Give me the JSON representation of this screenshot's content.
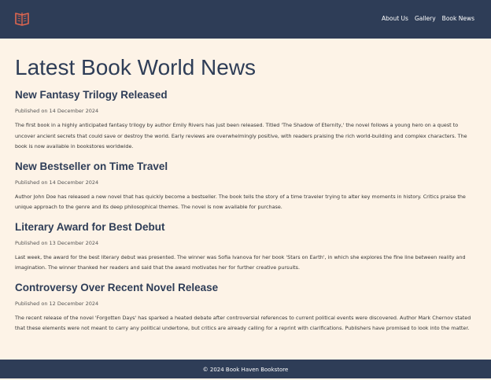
{
  "header": {
    "logo_icon": "book-logo-icon",
    "nav": [
      "About Us",
      "Gallery",
      "Book News"
    ]
  },
  "main": {
    "title": "Latest Book World News",
    "articles": [
      {
        "title": "New Fantasy Trilogy Released",
        "date": "Published on 14 December 2024",
        "body": "The first book in a highly anticipated fantasy trilogy by author Emily Rivers has just been released. Titled 'The Shadow of Eternity,' the novel follows a young hero on a quest to uncover ancient secrets that could save or destroy the world. Early reviews are overwhelmingly positive, with readers praising the rich world-building and complex characters. The book is now available in bookstores worldwide."
      },
      {
        "title": "New Bestseller on Time Travel",
        "date": "Published on 14 December 2024",
        "body": "Author John Doe has released a new novel that has quickly become a bestseller. The book tells the story of a time traveler trying to alter key moments in history. Critics praise the unique approach to the genre and its deep philosophical themes. The novel is now available for purchase."
      },
      {
        "title": "Literary Award for Best Debut",
        "date": "Published on 13 December 2024",
        "body": "Last week, the award for the best literary debut was presented. The winner was Sofia Ivanova for her book 'Stars on Earth', in which she explores the fine line between reality and imagination. The winner thanked her readers and said that the award motivates her for further creative pursuits."
      },
      {
        "title": "Controversy Over Recent Novel Release",
        "date": "Published on 12 December 2024",
        "body": "The recent release of the novel 'Forgotten Days' has sparked a heated debate after controversial references to current political events were discovered. Author Mark Chernov stated that these elements were not meant to carry any political undertone, but critics are already calling for a reprint with clarifications. Publishers have promised to look into the matter."
      }
    ]
  },
  "footer": {
    "text": "© 2024 Book Haven Bookstore"
  },
  "colors": {
    "header_bg": "#2e3d57",
    "page_bg": "#fdf3e7",
    "logo_accent": "#e0664f"
  }
}
